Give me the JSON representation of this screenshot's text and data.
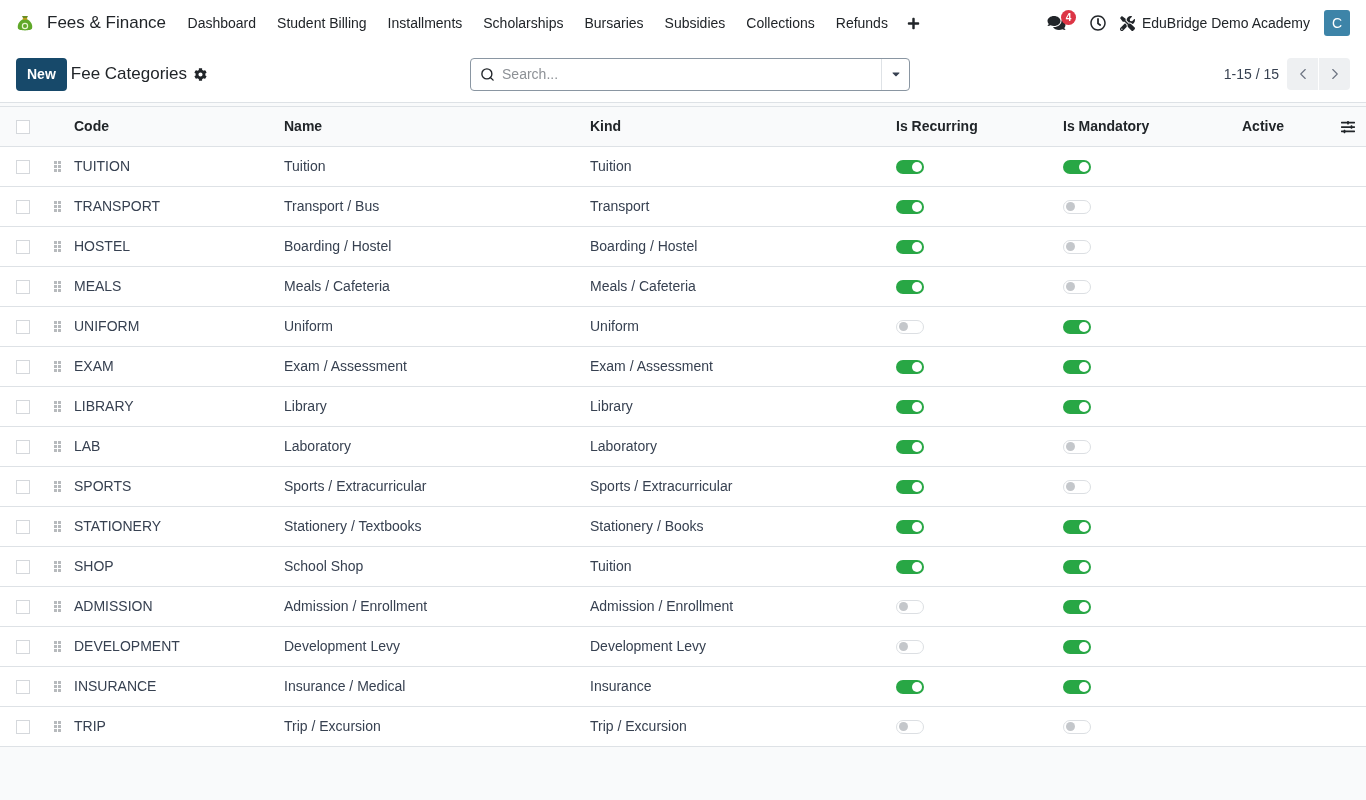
{
  "navbar": {
    "app_name": "Fees & Finance",
    "menu": [
      "Dashboard",
      "Student Billing",
      "Installments",
      "Scholarships",
      "Bursaries",
      "Subsidies",
      "Collections",
      "Refunds"
    ],
    "messages_count": "4",
    "company": "EduBridge Demo Academy",
    "avatar_letter": "C"
  },
  "control_panel": {
    "new_button": "New",
    "title": "Fee Categories",
    "search": {
      "placeholder": "Search..."
    },
    "pager": "1-15 / 15"
  },
  "table": {
    "all_checked": false,
    "columns": [
      "Code",
      "Name",
      "Kind",
      "Is Recurring",
      "Is Mandatory",
      "Active"
    ],
    "rows": [
      {
        "checked": false,
        "code": "TUITION",
        "name": "Tuition",
        "kind": "Tuition",
        "is_recurring": true,
        "is_mandatory": true
      },
      {
        "checked": false,
        "code": "TRANSPORT",
        "name": "Transport / Bus",
        "kind": "Transport",
        "is_recurring": true,
        "is_mandatory": false
      },
      {
        "checked": false,
        "code": "HOSTEL",
        "name": "Boarding / Hostel",
        "kind": "Boarding / Hostel",
        "is_recurring": true,
        "is_mandatory": false
      },
      {
        "checked": false,
        "code": "MEALS",
        "name": "Meals / Cafeteria",
        "kind": "Meals / Cafeteria",
        "is_recurring": true,
        "is_mandatory": false
      },
      {
        "checked": false,
        "code": "UNIFORM",
        "name": "Uniform",
        "kind": "Uniform",
        "is_recurring": false,
        "is_mandatory": true
      },
      {
        "checked": false,
        "code": "EXAM",
        "name": "Exam / Assessment",
        "kind": "Exam / Assessment",
        "is_recurring": true,
        "is_mandatory": true
      },
      {
        "checked": false,
        "code": "LIBRARY",
        "name": "Library",
        "kind": "Library",
        "is_recurring": true,
        "is_mandatory": true
      },
      {
        "checked": false,
        "code": "LAB",
        "name": "Laboratory",
        "kind": "Laboratory",
        "is_recurring": true,
        "is_mandatory": false
      },
      {
        "checked": false,
        "code": "SPORTS",
        "name": "Sports / Extracurricular",
        "kind": "Sports / Extracurricular",
        "is_recurring": true,
        "is_mandatory": false
      },
      {
        "checked": false,
        "code": "STATIONERY",
        "name": "Stationery / Textbooks",
        "kind": "Stationery / Books",
        "is_recurring": true,
        "is_mandatory": true
      },
      {
        "checked": false,
        "code": "SHOP",
        "name": "School Shop",
        "kind": "Tuition",
        "is_recurring": true,
        "is_mandatory": true
      },
      {
        "checked": false,
        "code": "ADMISSION",
        "name": "Admission / Enrollment",
        "kind": "Admission / Enrollment",
        "is_recurring": false,
        "is_mandatory": true
      },
      {
        "checked": false,
        "code": "DEVELOPMENT",
        "name": "Development Levy",
        "kind": "Development Levy",
        "is_recurring": false,
        "is_mandatory": true
      },
      {
        "checked": false,
        "code": "INSURANCE",
        "name": "Insurance / Medical",
        "kind": "Insurance",
        "is_recurring": true,
        "is_mandatory": true
      },
      {
        "checked": false,
        "code": "TRIP",
        "name": "Trip / Excursion",
        "kind": "Trip / Excursion",
        "is_recurring": false,
        "is_mandatory": false
      }
    ]
  }
}
